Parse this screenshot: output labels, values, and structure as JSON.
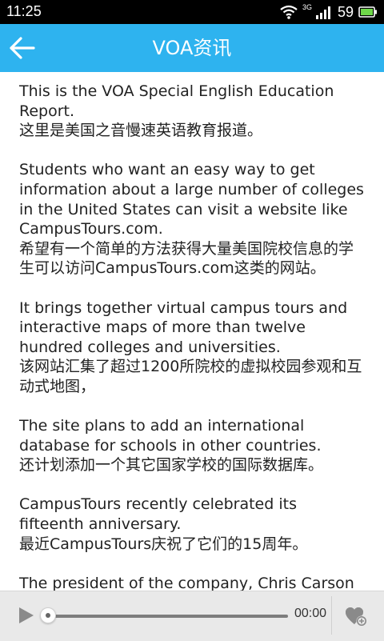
{
  "status_bar": {
    "time": "11:25",
    "network_type": "3G",
    "battery_level": "59",
    "icons": [
      "wifi-icon",
      "signal-icon",
      "battery-icon"
    ]
  },
  "header": {
    "title": "VOA资讯",
    "back_icon": "back-arrow-icon",
    "background_color": "#2eb3ef"
  },
  "article": {
    "paragraphs": [
      {
        "en": "This is the VOA Special English Education Report.",
        "zh": "这里是美国之音慢速英语教育报道。"
      },
      {
        "en": "Students who want an easy way to get information about a large number of colleges in the United States can visit a website like CampusTours.com.",
        "zh": "希望有一个简单的方法获得大量美国院校信息的学生可以访问CampusTours.com这类的网站。"
      },
      {
        "en": "It brings together virtual campus tours and interactive maps of more than twelve hundred colleges and universities.",
        "zh": "该网站汇集了超过1200所院校的虚拟校园参观和互动式地图，"
      },
      {
        "en": "The site plans to add an international database for schools in other countries.",
        "zh": "还计划添加一个其它国家学校的国际数据库。"
      },
      {
        "en": "CampusTours recently celebrated its fifteenth anniversary.",
        "zh": "最近CampusTours庆祝了它们的15周年。"
      },
      {
        "en": "The president of the company, Chris Carson",
        "zh": ""
      }
    ]
  },
  "player": {
    "play_icon": "play-icon",
    "time": "00:00",
    "progress": 0,
    "favorite_icon": "heart-add-icon"
  }
}
